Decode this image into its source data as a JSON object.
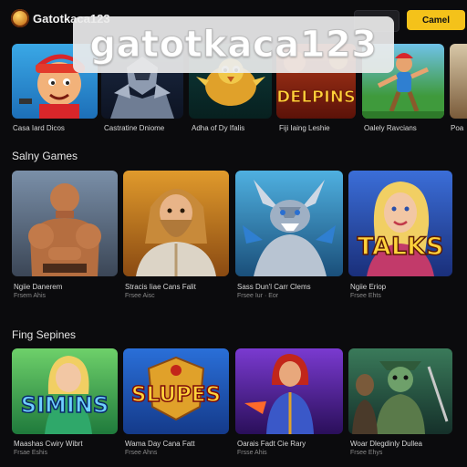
{
  "header": {
    "site_name": "Gatotkaca123",
    "primary_button": "Camel"
  },
  "watermark": "gatotkaca123",
  "row1": {
    "cards": [
      {
        "label": "Casa Iard Dicos",
        "art": "cartoon-boy"
      },
      {
        "label": "Castratine Dniome",
        "art": "armored-knight"
      },
      {
        "label": "Adha of Dy Ifalis",
        "art": "golden-bird"
      },
      {
        "label": "Fiji Iaing Leshie",
        "art": "delpins",
        "art_text": "DELPINS"
      },
      {
        "label": "Oalely Ravcians",
        "art": "jungle-warrior"
      },
      {
        "label": "Poa",
        "art": "partial"
      }
    ]
  },
  "row2": {
    "title": "Salny Games",
    "cards": [
      {
        "label": "Ngiie Danerem",
        "sub": "Frsem Ahis",
        "art": "muscular-brawler"
      },
      {
        "label": "Stracis Iiae Cans Falit",
        "sub": "Frsee Aisc",
        "art": "bearded-wizard"
      },
      {
        "label": "Sass Dun'l Carr Clems",
        "sub": "Frsee Iur · Eor",
        "art": "silver-dragon"
      },
      {
        "label": "Ngiie Eriop",
        "sub": "Frsee Ehts",
        "art": "talks-girl",
        "art_text": "TALKS"
      }
    ]
  },
  "row3": {
    "title": "Fing Sepines",
    "cards": [
      {
        "label": "Maashas Cwiry Wibrt",
        "sub": "Frsae Eshis",
        "art": "simins",
        "art_text": "SIMINS"
      },
      {
        "label": "Wama Day Cana Fatt",
        "sub": "Frsee Ahns",
        "art": "slupes",
        "art_text": "SLUPES"
      },
      {
        "label": "Oarais Fadt Cie Rary",
        "sub": "Frsse Ahis",
        "art": "red-heroine"
      },
      {
        "label": "Woar Dlegdinly Dullea",
        "sub": "Frsee Ehys",
        "art": "orc-warriors"
      }
    ]
  },
  "colors": {
    "background": "#0b0b0d",
    "accent_yellow": "#f4c21a"
  }
}
